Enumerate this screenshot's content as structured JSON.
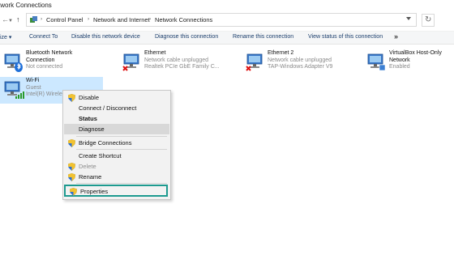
{
  "window": {
    "title": "twork Connections"
  },
  "address": {
    "crumbs": [
      "Control Panel",
      "Network and Internet",
      "Network Connections"
    ]
  },
  "toolbar": {
    "items": [
      "ize",
      "Connect To",
      "Disable this network device",
      "Diagnose this connection",
      "Rename this connection",
      "View status of this connection"
    ],
    "more": "»"
  },
  "adapters": [
    {
      "name": "Bluetooth Network",
      "name2": "Connection",
      "line1": "Not connected",
      "line2": "",
      "icon": "bluetooth-adapter-icon"
    },
    {
      "name": "Ethernet",
      "name2": "",
      "line1": "Network cable unplugged",
      "line2": "Realtek PCIe GbE Family C...",
      "icon": "ethernet-adapter-icon"
    },
    {
      "name": "Ethernet 2",
      "name2": "",
      "line1": "Network cable unplugged",
      "line2": "TAP-Windows Adapter V9",
      "icon": "ethernet-adapter-icon"
    },
    {
      "name": "VirtualBox Host-Only",
      "name2": "Network",
      "line1": "Enabled",
      "line2": "",
      "icon": "virtualbox-adapter-icon"
    },
    {
      "name": "Wi-Fi",
      "name2": "",
      "line1": "Guest",
      "line2": "Intel(R) Wirele",
      "icon": "wifi-adapter-icon"
    }
  ],
  "context_menu": {
    "items": [
      "Disable",
      "Connect / Disconnect",
      "Status",
      "Diagnose",
      "Bridge Connections",
      "Create Shortcut",
      "Delete",
      "Rename",
      "Properties"
    ]
  },
  "colors": {
    "selection": "#cce8ff",
    "highlight_box": "#1d9a8f",
    "link": "#1a3d6b"
  }
}
